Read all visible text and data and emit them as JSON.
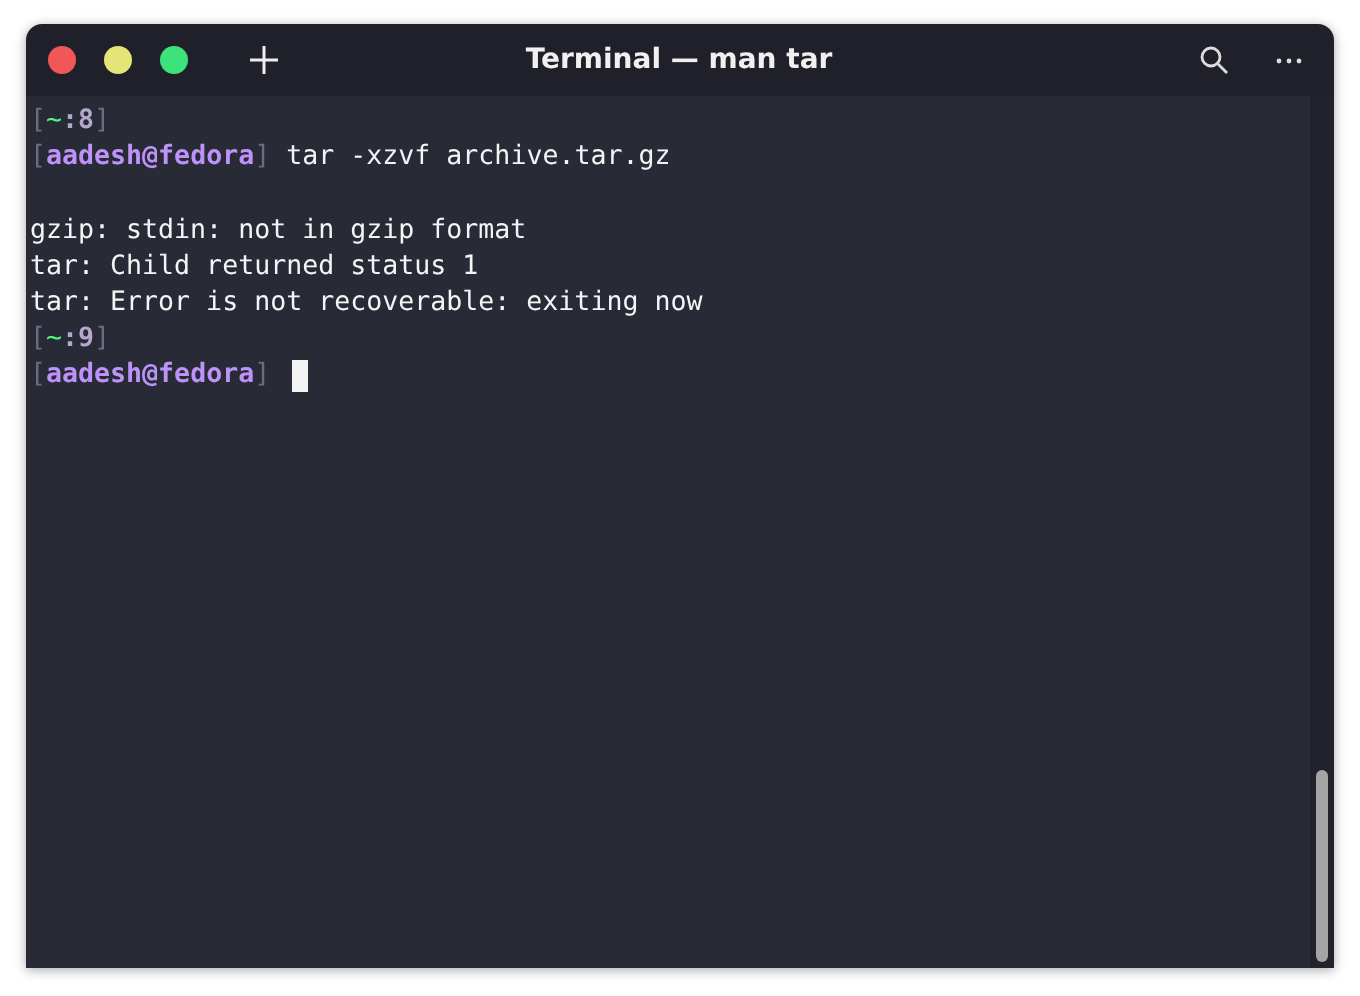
{
  "window": {
    "title": "Terminal — man tar"
  },
  "lines": [
    {
      "kind": "text",
      "segments": [
        {
          "kind": "bracket",
          "text": "["
        },
        {
          "kind": "tilde",
          "text": "~"
        },
        {
          "kind": "num",
          "text": ":8"
        },
        {
          "kind": "bracket",
          "text": "]"
        }
      ]
    },
    {
      "kind": "text",
      "segments": [
        {
          "kind": "bracket",
          "text": "["
        },
        {
          "kind": "user",
          "text": "aadesh@fedora"
        },
        {
          "kind": "bracket",
          "text": "]"
        },
        {
          "kind": "plain",
          "text": " tar -xzvf archive.tar.gz"
        }
      ]
    },
    {
      "kind": "blank"
    },
    {
      "kind": "text",
      "segments": [
        {
          "kind": "plain",
          "text": "gzip: stdin: not in gzip format"
        }
      ]
    },
    {
      "kind": "text",
      "segments": [
        {
          "kind": "plain",
          "text": "tar: Child returned status 1"
        }
      ]
    },
    {
      "kind": "text",
      "segments": [
        {
          "kind": "plain",
          "text": "tar: Error is not recoverable: exiting now"
        }
      ]
    },
    {
      "kind": "text",
      "segments": [
        {
          "kind": "bracket",
          "text": "["
        },
        {
          "kind": "tilde",
          "text": "~"
        },
        {
          "kind": "num",
          "text": ":9"
        },
        {
          "kind": "bracket",
          "text": "]"
        }
      ]
    },
    {
      "kind": "text",
      "cursor": true,
      "segments": [
        {
          "kind": "bracket",
          "text": "["
        },
        {
          "kind": "user",
          "text": "aadesh@fedora"
        },
        {
          "kind": "bracket",
          "text": "]"
        }
      ]
    }
  ]
}
